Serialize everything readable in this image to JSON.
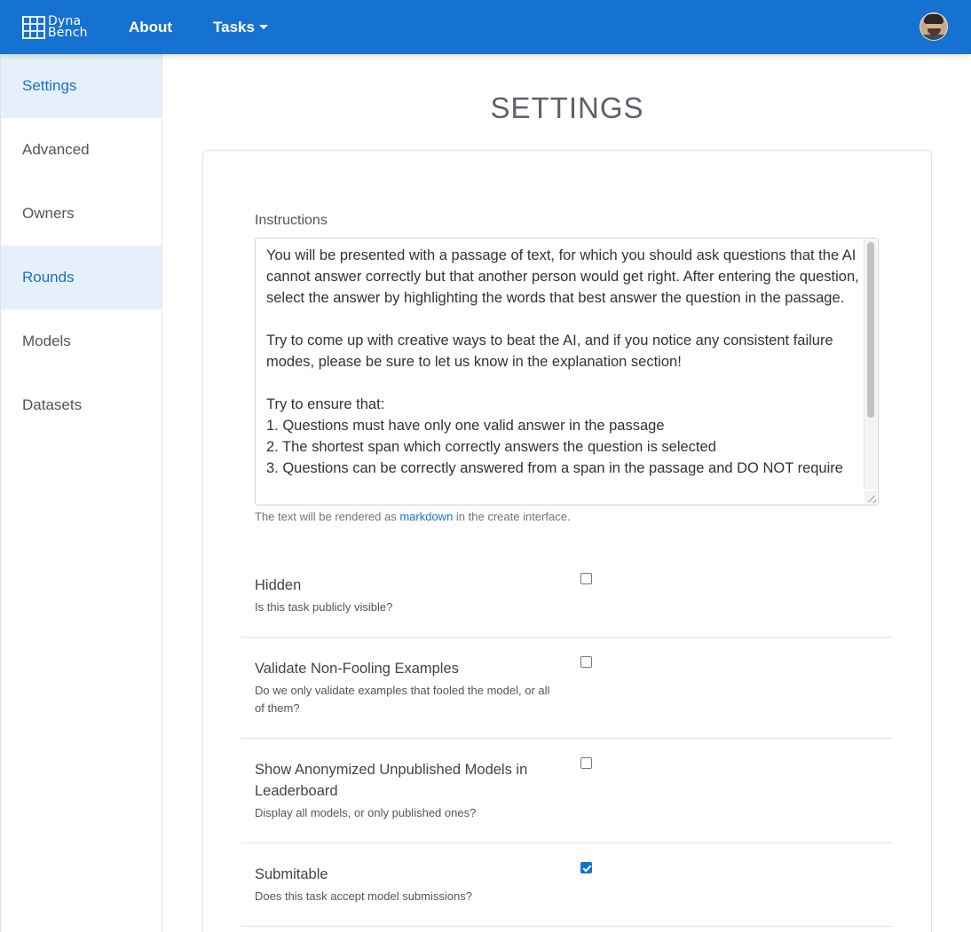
{
  "navbar": {
    "brand_line1": "Dyna",
    "brand_line2": "Bench",
    "about": "About",
    "tasks": "Tasks",
    "brand_color": "#1672d1"
  },
  "sidebar": {
    "items": [
      {
        "label": "Settings",
        "active": true
      },
      {
        "label": "Advanced",
        "active": false
      },
      {
        "label": "Owners",
        "active": false
      },
      {
        "label": "Rounds",
        "active": true
      },
      {
        "label": "Models",
        "active": false
      },
      {
        "label": "Datasets",
        "active": false
      }
    ]
  },
  "page": {
    "title": "SETTINGS"
  },
  "instructions": {
    "label": "Instructions",
    "value": "You will be presented with a passage of text, for which you should ask questions that the AI cannot answer correctly but that another person would get right. After entering the question, select the answer by highlighting the words that best answer the question in the passage.\n\nTry to come up with creative ways to beat the AI, and if you notice any consistent failure modes, please be sure to let us know in the explanation section!\n\nTry to ensure that:\n1. Questions must have only one valid answer in the passage\n2. The shortest span which correctly answers the question is selected\n3. Questions can be correctly answered from a span in the passage and DO NOT require",
    "help_prefix": "The text will be rendered as",
    "help_link": "markdown",
    "help_suffix": "in the create interface."
  },
  "settings": [
    {
      "title": "Hidden",
      "description": "Is this task publicly visible?",
      "checked": false
    },
    {
      "title": "Validate Non-Fooling Examples",
      "description": "Do we only validate examples that fooled the model, or all of them?",
      "checked": false
    },
    {
      "title": "Show Anonymized Unpublished Models in Leaderboard",
      "description": "Display all models, or only published ones?",
      "checked": false
    },
    {
      "title": "Submitable",
      "description": "Does this task accept model submissions?",
      "checked": true
    }
  ]
}
